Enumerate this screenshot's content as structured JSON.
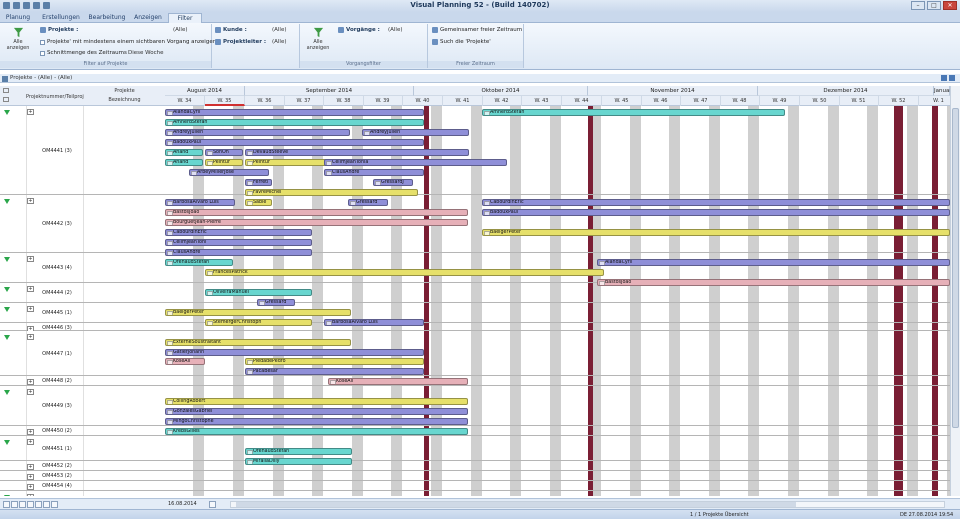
{
  "app": {
    "title": "Visual Planning 52 - (Build 140702)"
  },
  "ribbon_tabs": [
    "Planung",
    "Erstellungen",
    "Bearbeitung",
    "Anzeigen",
    "Filter"
  ],
  "ribbon": {
    "alle_anzeigen_1": "Alle anzeigen",
    "projekte_label": "Projekte :",
    "projekte_value": "(Alle)",
    "projekte_checkbox": "Projekte' mit mindestens einem sichtbaren Vorgang anzeigen",
    "schnittmenge_label": "Schnittmenge des Zeitraums",
    "schnittmenge_value": "Diese Woche",
    "kunde_label": "Kunde :",
    "kunde_value": "(Alle)",
    "projektleiter_label": "Projektleiter :",
    "projektleiter_value": "(Alle)",
    "group_filter_projekte": "Filter auf Projekte",
    "alle_anzeigen_2": "Alle anzeigen",
    "vorgaenge_label": "Vorgänge :",
    "vorgaenge_value": "(Alle)",
    "group_vorgangsfilter": "Vorgangsfilter",
    "gemeinsamer_freier_zeitraum": "Gemeinsamer freier Zeitraum",
    "suche_projekte": "Such die 'Projekte'",
    "group_freier_zeitraum": "Freier Zeitraum"
  },
  "subheader": "Projekte - (Alle) - (Alle)",
  "left_headers": {
    "projektnummer": "Projektnummer/Teilprojekt",
    "projekte": "Projekte",
    "bezeichnung": "Bezeichnung"
  },
  "months": [
    {
      "label": "August 2014"
    },
    {
      "label": "September 2014"
    },
    {
      "label": "Oktober 2014"
    },
    {
      "label": "November 2014"
    },
    {
      "label": "Dezember 2014"
    },
    {
      "label": "Januar"
    }
  ],
  "weeks": [
    "W. 34",
    "W. 35",
    "W. 36",
    "W. 37",
    "W. 38",
    "W. 39",
    "W. 40",
    "W. 41",
    "W. 42",
    "W. 43",
    "W. 44",
    "W. 45",
    "W. 46",
    "W. 47",
    "W. 48",
    "W. 49",
    "W. 50",
    "W. 51",
    "W. 52",
    "W. 1"
  ],
  "projects": [
    {
      "name": "OM4441 (3)"
    },
    {
      "name": "OM4442 (3)"
    },
    {
      "name": "OM4443 (4)"
    },
    {
      "name": "OM4444 (2)"
    },
    {
      "name": "OM4445 (1)"
    },
    {
      "name": "OM4446 (3)"
    },
    {
      "name": "OM4447 (1)"
    },
    {
      "name": "OM4448 (2)"
    },
    {
      "name": "OM4449 (3)"
    },
    {
      "name": "OM4450 (2)"
    },
    {
      "name": "OM4451 (1)"
    },
    {
      "name": "OM4452 (2)"
    },
    {
      "name": "OM4453 (2)"
    },
    {
      "name": "OM4454 (4)"
    },
    {
      "name": "OM4455 (3)"
    }
  ],
  "tasks": [
    {
      "label": "AlandaCyril",
      "color": "#8f8fd8"
    },
    {
      "label": "AmherdStefan",
      "color": "#68d6cf"
    },
    {
      "label": "AmherdStefan",
      "color": "#68d6cf"
    },
    {
      "label": "AndreyJulien",
      "color": "#8f8fd8"
    },
    {
      "label": "AndreyJulien",
      "color": "#8f8fd8"
    },
    {
      "label": "BadouxPaul",
      "color": "#8f8fd8"
    },
    {
      "label": "Anand",
      "color": "#68d6cf"
    },
    {
      "label": "SonOh",
      "color": "#8f8fd8"
    },
    {
      "label": "DevaudSteeve",
      "color": "#8f8fd8"
    },
    {
      "label": "Anand",
      "color": "#68d6cf"
    },
    {
      "label": "Peintur",
      "color": "#e6e06a"
    },
    {
      "label": "Peintur",
      "color": "#e6e06a"
    },
    {
      "label": "CellmjeanTonia",
      "color": "#8f8fd8"
    },
    {
      "label": "ArbeyMillerJosé",
      "color": "#8f8fd8"
    },
    {
      "label": "ClausAndre",
      "color": "#8f8fd8"
    },
    {
      "label": "Ferreti",
      "color": "#8f8fd8"
    },
    {
      "label": "GressardJ",
      "color": "#8f8fd8"
    },
    {
      "label": "FavreMichel",
      "color": "#e6e06a"
    },
    {
      "label": "BarbosaAlvaro Luis",
      "color": "#8f8fd8"
    },
    {
      "label": "Sable",
      "color": "#e6e06a"
    },
    {
      "label": "Gressard",
      "color": "#8f8fd8"
    },
    {
      "label": "CabourdinEric",
      "color": "#8f8fd8"
    },
    {
      "label": "BastosJoao",
      "color": "#e6b0b8"
    },
    {
      "label": "BadouxPaul",
      "color": "#8f8fd8"
    },
    {
      "label": "BourguetJean-Pierre",
      "color": "#e6b0b8"
    },
    {
      "label": "CabourdinEric",
      "color": "#8f8fd8"
    },
    {
      "label": "BaeigerPeter",
      "color": "#e6e06a"
    },
    {
      "label": "CellmjeanToni",
      "color": "#8f8fd8"
    },
    {
      "label": "ClausAndre",
      "color": "#8f8fd8"
    },
    {
      "label": "OrenaudStefan",
      "color": "#68d6cf"
    },
    {
      "label": "AlandaCyril",
      "color": "#8f8fd8"
    },
    {
      "label": "FrancesPatrick",
      "color": "#e6e06a"
    },
    {
      "label": "BastosJoao",
      "color": "#e6b0b8"
    },
    {
      "label": "OliveiraManuel",
      "color": "#68d6cf"
    },
    {
      "label": "Gressard",
      "color": "#8f8fd8"
    },
    {
      "label": "BaeigerPeter",
      "color": "#e6e06a"
    },
    {
      "label": "StemergerChristoph",
      "color": "#e6e06a"
    },
    {
      "label": "BarbosaAlvaro Luis",
      "color": "#8f8fd8"
    },
    {
      "label": "ExterneSoustraitant",
      "color": "#e6e06a"
    },
    {
      "label": "GatlerJohann",
      "color": "#8f8fd8"
    },
    {
      "label": "KöseAli",
      "color": "#e6b0b8"
    },
    {
      "label": "PiedadePedro",
      "color": "#e6e06a"
    },
    {
      "label": "PacaBesar",
      "color": "#8f8fd8"
    },
    {
      "label": "KöseAli",
      "color": "#e6b0b8"
    },
    {
      "label": "CollingRobert",
      "color": "#e6e06a"
    },
    {
      "label": "GonzalesGabriel",
      "color": "#8f8fd8"
    },
    {
      "label": "MingoChristophe",
      "color": "#8f8fd8"
    },
    {
      "label": "KrebsGilles",
      "color": "#68d6cf"
    },
    {
      "label": "OrenaudStefan",
      "color": "#68d6cf"
    },
    {
      "label": "MirallaDilly",
      "color": "#68d6cf"
    }
  ],
  "bottom": {
    "date": "16.08.2014"
  },
  "status": {
    "projects": "1 / 1 Projekte Übersicht",
    "datetime": "DE 27.08.2014 19:54"
  }
}
